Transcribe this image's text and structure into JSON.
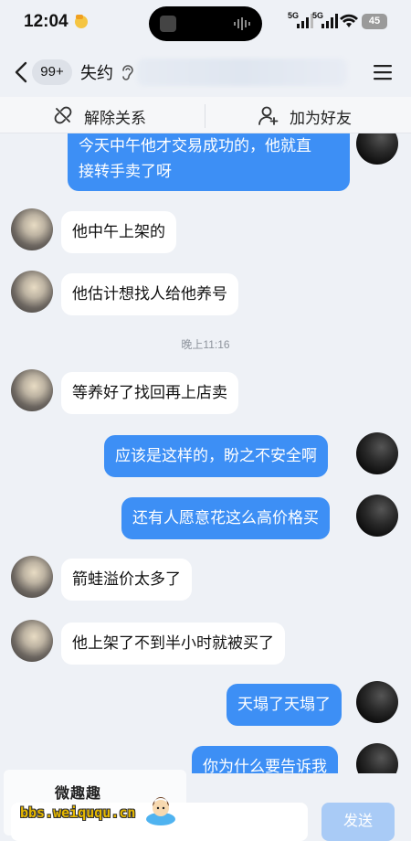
{
  "status_bar": {
    "time": "12:04",
    "signal1_label": "5G",
    "signal2_label": "5G",
    "battery": "45"
  },
  "header": {
    "unread_badge": "99+",
    "contact_name": "失约"
  },
  "action_bar": {
    "unfriend_label": "解除关系",
    "add_friend_label": "加为好友"
  },
  "messages": [
    {
      "side": "self",
      "text_line1": "今天中午他才交易成功的，他就直",
      "text_line2": "接转手卖了呀"
    },
    {
      "side": "other",
      "text": "他中午上架的"
    },
    {
      "side": "other",
      "text": "他估计想找人给他养号"
    },
    {
      "type": "timestamp",
      "text": "晚上11:16"
    },
    {
      "side": "other",
      "text": "等养好了找回再上店卖"
    },
    {
      "side": "self",
      "text": "应该是这样的，盼之不安全啊"
    },
    {
      "side": "self",
      "text": "还有人愿意花这么高价格买"
    },
    {
      "side": "other",
      "text": "箭蛙溢价太多了"
    },
    {
      "side": "other",
      "text": "他上架了不到半小时就被买了"
    },
    {
      "side": "self",
      "text": "天塌了天塌了"
    },
    {
      "side": "self",
      "text": "你为什么要告诉我"
    }
  ],
  "input_bar": {
    "input_value": "",
    "send_label": "发送"
  },
  "watermark": {
    "title": "微趣趣",
    "url": "bbs.weiququ.cn"
  },
  "colors": {
    "self_bubble": "#3d8ff5",
    "other_bubble": "#ffffff",
    "background": "#eef1f6",
    "send_disabled": "#a9cbf6"
  }
}
